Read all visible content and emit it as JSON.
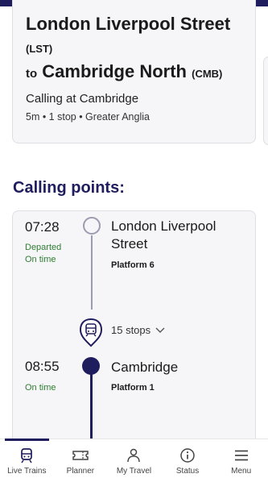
{
  "journey": {
    "origin": "London Liverpool Street",
    "origin_code": "(LST)",
    "to_word": "to",
    "destination": "Cambridge North",
    "destination_code": "(CMB)",
    "calling_at": "Calling at Cambridge",
    "meta": "5m • 1 stop • Greater Anglia"
  },
  "calling_points": {
    "title": "Calling points:",
    "stops": [
      {
        "time": "07:28",
        "status_line1": "Departed",
        "status_line2": "On time",
        "station_line1": "London Liverpool",
        "station_line2": "Street",
        "platform": "Platform 6"
      },
      {
        "time": "08:55",
        "status_line1": "On time",
        "station_line1": "Cambridge",
        "platform": "Platform 1"
      }
    ],
    "intermediate_stops_label": "15 stops"
  },
  "bottom_nav": {
    "items": [
      {
        "label": "Live Trains",
        "icon": "train-icon",
        "active": true
      },
      {
        "label": "Planner",
        "icon": "ticket-icon",
        "active": false
      },
      {
        "label": "My Travel",
        "icon": "person-icon",
        "active": false
      },
      {
        "label": "Status",
        "icon": "info-icon",
        "active": false
      },
      {
        "label": "Menu",
        "icon": "menu-icon",
        "active": false
      }
    ]
  },
  "colors": {
    "brand_navy": "#1f1d5e",
    "status_green": "#2e7d32",
    "line_grey": "#9c9cb0"
  }
}
